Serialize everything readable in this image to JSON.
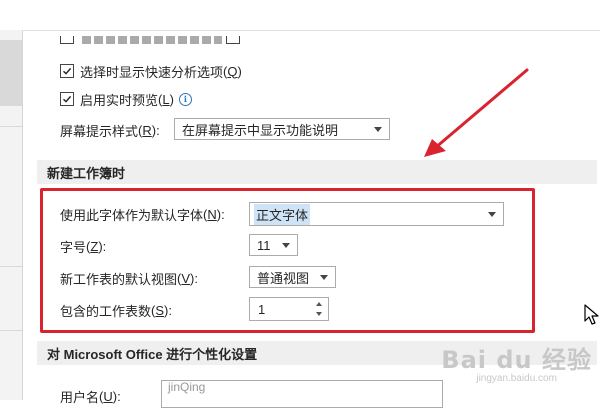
{
  "options": {
    "quick_analysis": {
      "label": "选择时显示快速分析选项",
      "key": "Q",
      "checked": true
    },
    "live_preview": {
      "label": "启用实时预览",
      "key": "L",
      "checked": true
    },
    "tooltip_style": {
      "label": "屏幕提示样式",
      "key": "R",
      "value": "在屏幕提示中显示功能说明"
    }
  },
  "new_workbook": {
    "title": "新建工作簿时",
    "font": {
      "label": "使用此字体作为默认字体",
      "key": "N",
      "value": "正文字体"
    },
    "size": {
      "label": "字号",
      "key": "Z",
      "value": "11"
    },
    "view": {
      "label": "新工作表的默认视图",
      "key": "V",
      "value": "普通视图"
    },
    "sheets": {
      "label": "包含的工作表数",
      "key": "S",
      "value": "1"
    }
  },
  "personalize": {
    "title": "对 Microsoft Office 进行个性化设置",
    "username": {
      "label": "用户名",
      "key": "U",
      "value": "jinQing"
    }
  },
  "watermark": {
    "main": "Bai du 经验",
    "sub": "jingyan.baidu.com"
  },
  "colors": {
    "highlight": "#d9232e",
    "accent": "#2e75b6"
  }
}
